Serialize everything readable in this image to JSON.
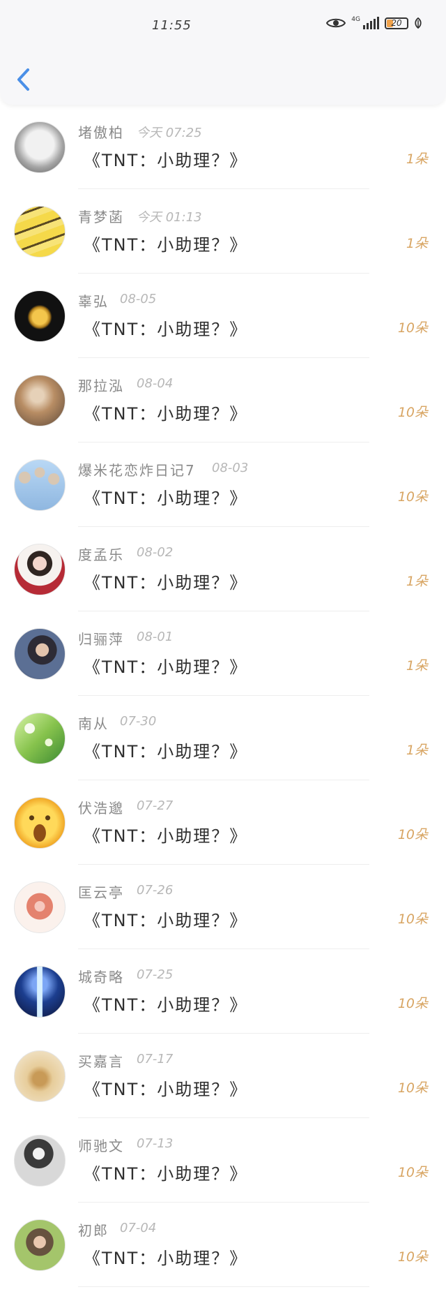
{
  "status_bar": {
    "time": "11:55",
    "network": "4G",
    "battery": "20"
  },
  "colors": {
    "accent": "#4a8fe7",
    "count": "#d8a563",
    "meta": "#b7b7b7"
  },
  "items": [
    {
      "name": "堵傲柏",
      "date": "今天 07:25",
      "title": "《TNT：小助理？》",
      "count": "1朵"
    },
    {
      "name": "青梦菡",
      "date": "今天 01:13",
      "title": "《TNT：小助理？》",
      "count": "1朵"
    },
    {
      "name": "辜弘",
      "date": "08-05",
      "title": "《TNT：小助理？》",
      "count": "10朵"
    },
    {
      "name": "那拉泓",
      "date": "08-04",
      "title": "《TNT：小助理？》",
      "count": "10朵"
    },
    {
      "name": "爆米花恋炸日记7",
      "date": "08-03",
      "title": "《TNT：小助理？》",
      "count": "10朵"
    },
    {
      "name": "度孟乐",
      "date": "08-02",
      "title": "《TNT：小助理？》",
      "count": "1朵"
    },
    {
      "name": "归骊萍",
      "date": "08-01",
      "title": "《TNT：小助理？》",
      "count": "1朵"
    },
    {
      "name": "南从",
      "date": "07-30",
      "title": "《TNT：小助理？》",
      "count": "1朵"
    },
    {
      "name": "伏浩邈",
      "date": "07-27",
      "title": "《TNT：小助理？》",
      "count": "10朵"
    },
    {
      "name": "匡云亭",
      "date": "07-26",
      "title": "《TNT：小助理？》",
      "count": "10朵"
    },
    {
      "name": "城奇略",
      "date": "07-25",
      "title": "《TNT：小助理？》",
      "count": "10朵"
    },
    {
      "name": "买嘉言",
      "date": "07-17",
      "title": "《TNT：小助理？》",
      "count": "10朵"
    },
    {
      "name": "师驰文",
      "date": "07-13",
      "title": "《TNT：小助理？》",
      "count": "10朵"
    },
    {
      "name": "初郎",
      "date": "07-04",
      "title": "《TNT：小助理？》",
      "count": "10朵"
    }
  ]
}
